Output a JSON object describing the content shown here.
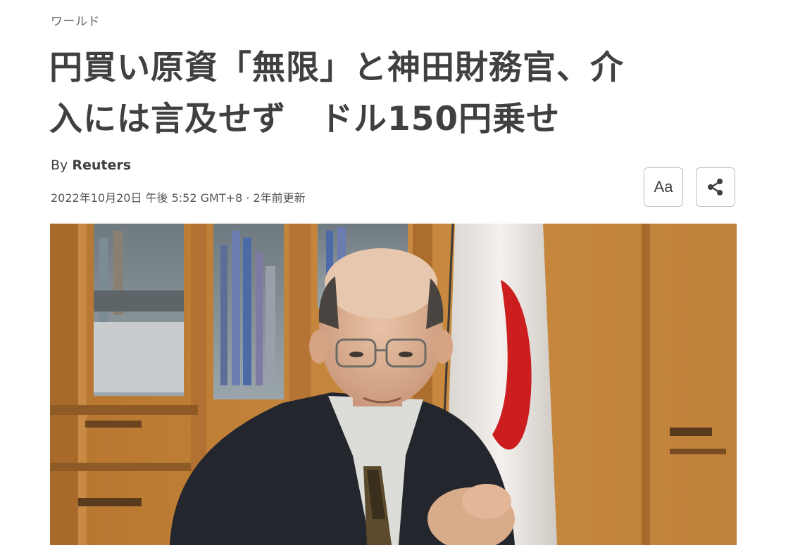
{
  "article": {
    "category": "ワールド",
    "headline_line1": "円買い原資「無限」と神田財務官、介",
    "headline_line2": "入には言及せず　ドル150円乗せ",
    "byline_prefix": "By ",
    "author": "Reuters",
    "dateline": "2022年10月20日 午後 5:52 GMT+8 · 2年前更新"
  },
  "toolbar": {
    "text_size_label": "Aa",
    "share_icon": "share-icon"
  },
  "hero_image": {
    "subject": "photo-man-with-japanese-flag"
  }
}
